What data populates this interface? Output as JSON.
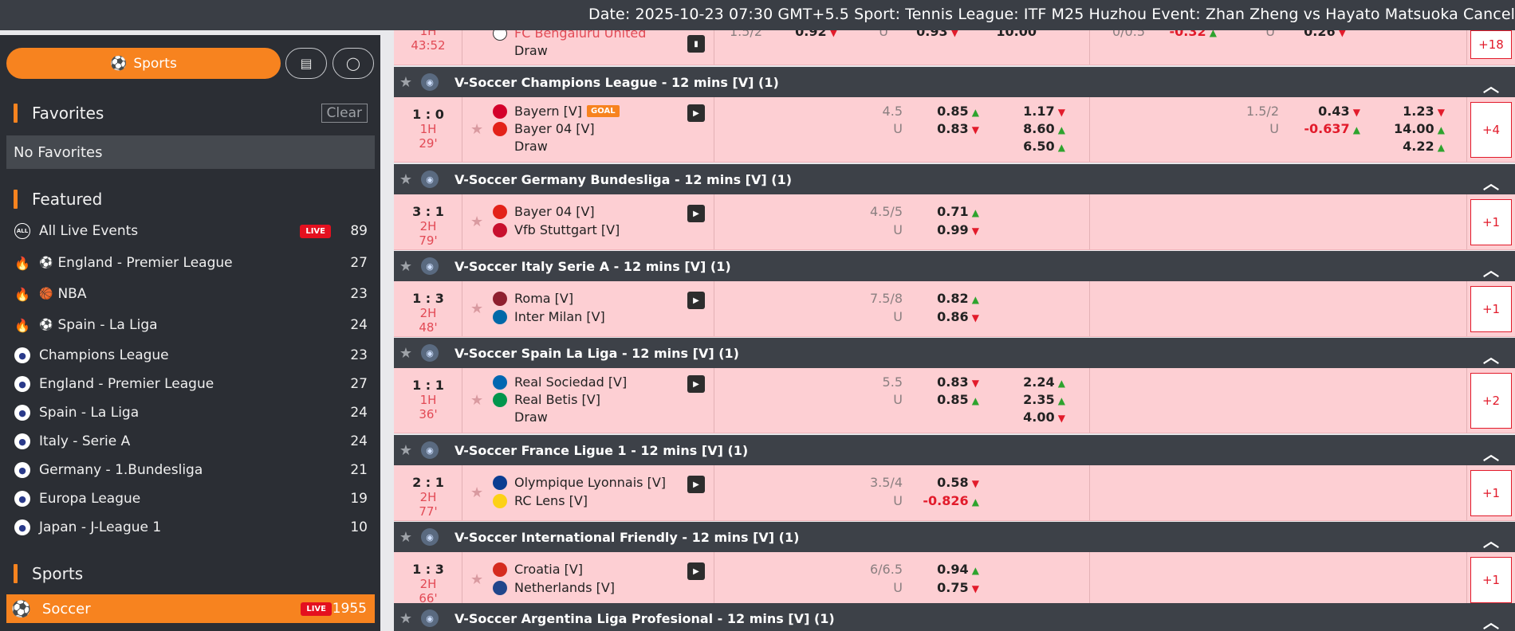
{
  "ticker": "Date: 2025-10-23 07:30 GMT+5.5 Sport: Tennis League: ITF M25 Huzhou Event: Zhan Zheng vs Hayato Matsuoka Cancel",
  "sidebar": {
    "sports_label": "Sports",
    "favorites_title": "Favorites",
    "clear_label": "Clear",
    "no_favorites": "No Favorites",
    "featured_title": "Featured",
    "featured": [
      {
        "label": "All Live Events",
        "count": "89",
        "live": "LIVE",
        "icon": "all-icon"
      },
      {
        "label": "England - Premier League",
        "count": "27",
        "icon": "fire-icon"
      },
      {
        "label": "NBA",
        "count": "23",
        "icon": "fire-icon"
      },
      {
        "label": "Spain - La Liga",
        "count": "24",
        "icon": "fire-icon"
      },
      {
        "label": "Champions League",
        "count": "23",
        "icon": "ucl-icon"
      },
      {
        "label": "England - Premier League",
        "count": "27",
        "icon": "epl-icon"
      },
      {
        "label": "Spain - La Liga",
        "count": "24",
        "icon": "laliga-icon"
      },
      {
        "label": "Italy - Serie A",
        "count": "24",
        "icon": "seriea-icon"
      },
      {
        "label": "Germany - 1.Bundesliga",
        "count": "21",
        "icon": "bundesliga-icon"
      },
      {
        "label": "Europa League",
        "count": "19",
        "icon": "uel-icon"
      },
      {
        "label": "Japan - J-League 1",
        "count": "10",
        "icon": "jleague-icon"
      }
    ],
    "sports_title": "Sports",
    "soccer": {
      "label": "Soccer",
      "live": "LIVE",
      "count": "1955"
    }
  },
  "top_partial": {
    "period": "1H",
    "time": "43:52",
    "team": "FC Bengaluru United",
    "draw": "Draw",
    "more": "+18",
    "ou_line": "1.5/2",
    "odd1": "0.92",
    "u": "U",
    "odd2": "0.93",
    "x12": "10.00",
    "ou_line2": "0/0.5",
    "odd3": "-0.32",
    "u2": "U",
    "odd4": "0.26"
  },
  "matches": [
    {
      "league": "V-Soccer Champions League - 12 mins [V] (1)",
      "score": "1 : 0",
      "period": "1H",
      "minute": "29'",
      "home": "Bayern [V]",
      "away": "Bayer 04 [V]",
      "draw": "Draw",
      "goal": "GOAL",
      "ou": "4.5",
      "u": "U",
      "o1": "0.85",
      "o1d": "up",
      "o2": "0.83",
      "o2d": "dn",
      "x1": "1.17",
      "x1d": "dn",
      "x2": "8.60",
      "x2d": "up",
      "x3": "6.50",
      "x3d": "up",
      "ou2": "1.5/2",
      "u2": "U",
      "h1": "0.43",
      "h1d": "dn",
      "h2": "-0.637",
      "h2d": "up",
      "y1": "1.23",
      "y1d": "dn",
      "y2": "14.00",
      "y2d": "up",
      "y3": "4.22",
      "y3d": "up",
      "more": "+4"
    },
    {
      "league": "V-Soccer Germany Bundesliga - 12 mins [V] (1)",
      "score": "3 : 1",
      "period": "2H",
      "minute": "79'",
      "home": "Bayer 04 [V]",
      "away": "Vfb Stuttgart [V]",
      "ou": "4.5/5",
      "u": "U",
      "o1": "0.71",
      "o1d": "up",
      "o2": "0.99",
      "o2d": "dn",
      "more": "+1"
    },
    {
      "league": "V-Soccer Italy Serie A - 12 mins [V] (1)",
      "score": "1 : 3",
      "period": "2H",
      "minute": "48'",
      "home": "Roma [V]",
      "away": "Inter Milan [V]",
      "ou": "7.5/8",
      "u": "U",
      "o1": "0.82",
      "o1d": "up",
      "o2": "0.86",
      "o2d": "dn",
      "more": "+1"
    },
    {
      "league": "V-Soccer Spain La Liga - 12 mins [V] (1)",
      "score": "1 : 1",
      "period": "1H",
      "minute": "36'",
      "home": "Real Sociedad [V]",
      "away": "Real Betis [V]",
      "draw": "Draw",
      "ou": "5.5",
      "u": "U",
      "o1": "0.83",
      "o1d": "dn",
      "o2": "0.85",
      "o2d": "up",
      "x1": "2.24",
      "x1d": "up",
      "x2": "2.35",
      "x2d": "up",
      "x3": "4.00",
      "x3d": "dn",
      "more": "+2"
    },
    {
      "league": "V-Soccer France Ligue 1 - 12 mins [V] (1)",
      "score": "2 : 1",
      "period": "2H",
      "minute": "77'",
      "home": "Olympique Lyonnais [V]",
      "away": "RC Lens [V]",
      "ou": "3.5/4",
      "u": "U",
      "o1": "0.58",
      "o1d": "dn",
      "o2": "-0.826",
      "o2d": "up",
      "more": "+1"
    },
    {
      "league": "V-Soccer International Friendly - 12 mins [V] (1)",
      "score": "1 : 3",
      "period": "2H",
      "minute": "66'",
      "home": "Croatia [V]",
      "away": "Netherlands [V]",
      "ou": "6/6.5",
      "u": "U",
      "o1": "0.94",
      "o1d": "up",
      "o2": "0.75",
      "o2d": "dn",
      "more": "+1"
    }
  ],
  "last_league": "V-Soccer Argentina Liga Profesional - 12 mins [V] (1)",
  "colors": {
    "accent": "#f7831f",
    "live": "#e4101f",
    "row_bg": "#fdcfd3",
    "header_bg": "#3d4148"
  }
}
